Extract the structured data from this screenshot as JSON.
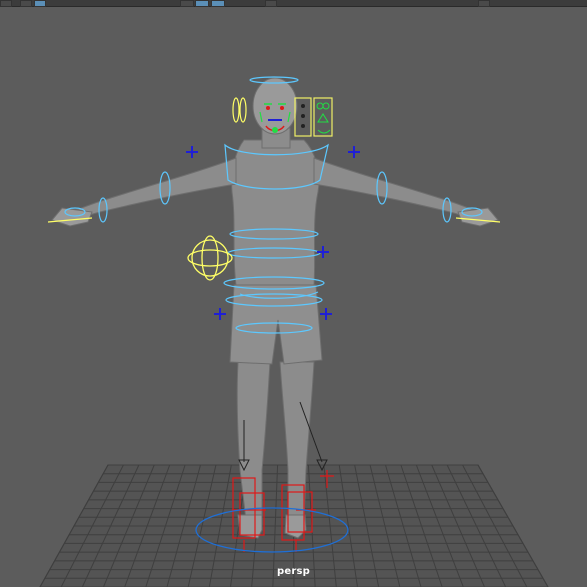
{
  "viewport": {
    "camera_label": "persp",
    "background": "#5c5c5c",
    "grid_color": "#3f3f3f",
    "mesh_color": "#8a8a8a",
    "control_colors": {
      "nurbs_curve": "#5cc8ff",
      "selected_curve": "#ffff66",
      "locator": "#1f1fd6",
      "ik_handle": "#e01818",
      "pole_vector": "#222222",
      "face_rig_frame": "#f0f066",
      "face_rig_green": "#22dd44"
    }
  },
  "toolbar": {
    "icons": [
      "viewport-menu-icon",
      "shading-toggle-icon",
      "camera-toggle-icon",
      "panel-layout-icon"
    ]
  }
}
